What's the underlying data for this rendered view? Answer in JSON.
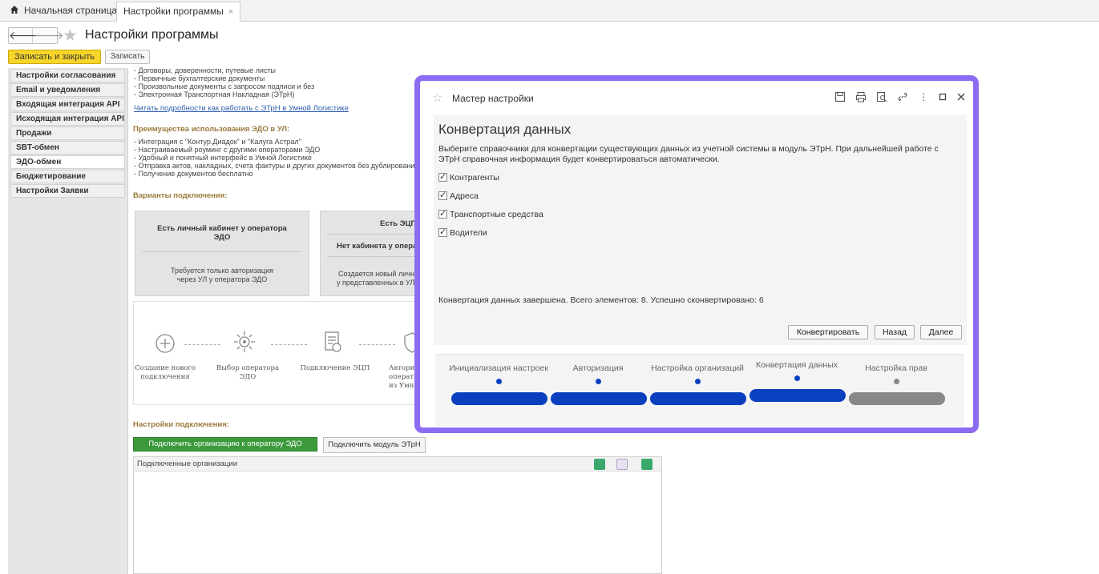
{
  "tabs": {
    "home": "Начальная страница",
    "settings": "Настройки программы",
    "close": "×"
  },
  "header": {
    "back": "🡐",
    "forward": "🡒",
    "title": "Настройки программы"
  },
  "toolbar": {
    "save_close": "Записать и закрыть",
    "save": "Записать"
  },
  "sidebar": {
    "items": [
      {
        "label": "Настройки согласования"
      },
      {
        "label": "Email и уведомления"
      },
      {
        "label": "Входящая интеграция API"
      },
      {
        "label": "Исходящая интеграция API"
      },
      {
        "label": "Продажи"
      },
      {
        "label": "SBT-обмен"
      },
      {
        "label": "ЭДО-обмен"
      },
      {
        "label": "Бюджетирование"
      },
      {
        "label": "Настройки Заявки"
      }
    ],
    "active": "ЭДО-обмен"
  },
  "content": {
    "doc_lines": [
      "- Договоры, доверенности, путевые листы",
      "- Первичные бухгалтерские документы",
      "- Произвольные документы с запросом подписи и без",
      "- Электронная Транспортная Накладная (ЭТрН)"
    ],
    "link": "Читать подробности как работать с ЭТрН в Умной Логистике",
    "advantages_header": "Преимущества использования ЭДО в УЛ:",
    "advantages": [
      "- Интеграция с \"Контур.Диадок\" и \"Калуга Астрал\"",
      "- Настраиваемый роуминг с другими операторами ЭДО",
      "- Удобный и понятный интерфейс в Умной Логистике",
      "- Отправка актов, накладных, счета фактуры и других документов без дублирования",
      "- Получение документов бесплатно"
    ],
    "variants_header": "Варианты подключения:",
    "card1": {
      "title1": "Есть личный кабинет у оператора",
      "title2": "ЭДО",
      "text1": "Требуется только авторизация",
      "text2": "через УЛ у оператора ЭДО"
    },
    "card2": {
      "title1": "Есть ЭЦП",
      "title2": "Нет кабинета у опера",
      "text1": "Создается новый личн",
      "text2": "у представленных в УЛ"
    },
    "steps": [
      {
        "line1": "Создание нового",
        "line2": "подключения"
      },
      {
        "line1": "Выбор оператора ЭДО",
        "line2": ""
      },
      {
        "line1": "Подключение ЭЦП",
        "line2": ""
      },
      {
        "line1": "Авториз",
        "line2": "операт",
        "line3": "из Умно"
      }
    ],
    "connection_header": "Настройки подключения:",
    "btn_connect_org": "Подключить организацию к оператору ЭДО",
    "btn_connect_etrn": "Подключить модуль ЭТрН",
    "orgs_header": "Подключенные организации"
  },
  "modal": {
    "title": "Мастер настройки",
    "heading": "Конвертация данных",
    "description": "Выберите справочники для конвертации существующих данных из учетной системы в модуль ЭТрН. При дальнейшей работе с ЭТрН справочная информация будет конвертироваться автоматически.",
    "checkboxes": [
      {
        "label": "Контрагенты",
        "checked": true
      },
      {
        "label": "Адреса",
        "checked": true
      },
      {
        "label": "Транспортные средства",
        "checked": true
      },
      {
        "label": "Водители",
        "checked": true
      }
    ],
    "status": "Конвертация данных завершена. Всего элементов: 8. Успешно сконвертировано: 6",
    "buttons": {
      "convert": "Конвертировать",
      "back": "Назад",
      "next": "Далее"
    },
    "progress_steps": [
      {
        "label": "Инициализация настроек",
        "state": "done"
      },
      {
        "label": "Авторизация",
        "state": "done"
      },
      {
        "label": "Настройка организаций",
        "state": "done"
      },
      {
        "label": "Конвертация данных",
        "state": "current"
      },
      {
        "label": "Настройка прав",
        "state": "pending"
      }
    ],
    "colors": {
      "frame": "#8c6cf2",
      "done": "#0a3fbf",
      "pending": "#888888"
    }
  }
}
